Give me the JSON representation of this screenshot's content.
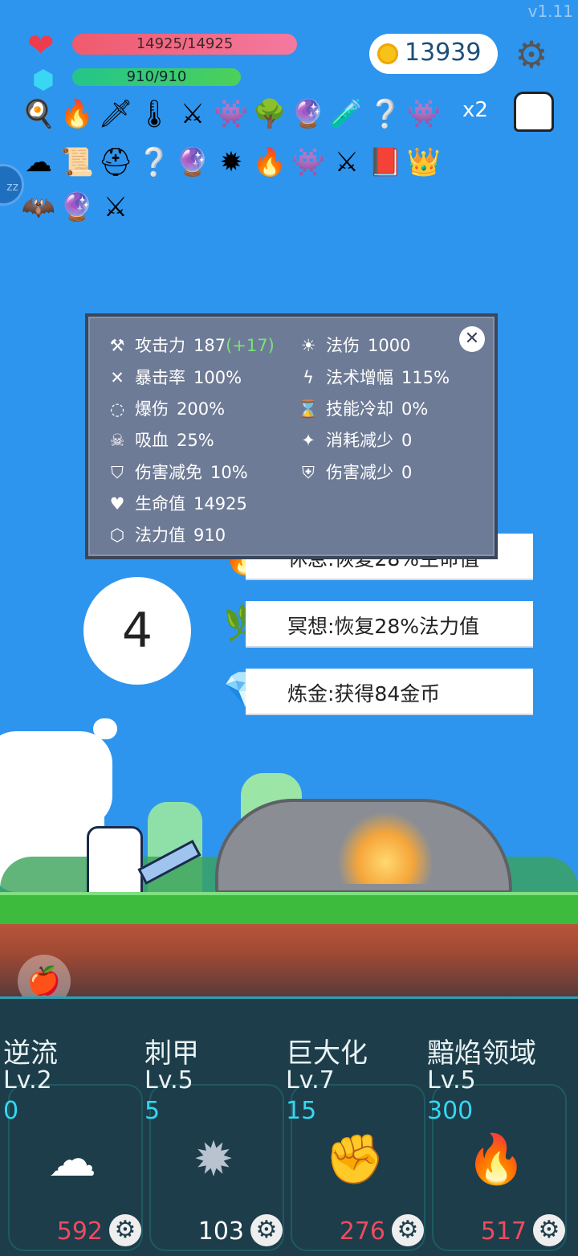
{
  "version": "v1.11",
  "hud": {
    "hp_text": "14925/14925",
    "mp_text": "910/910",
    "gold": "13939",
    "multiplier": "x2"
  },
  "inventory_icons": [
    "egg-icon",
    "torch-icon",
    "dagger-icon",
    "thermometer-icon",
    "sword-icon",
    "green-slime-icon",
    "tree-icon",
    "crystal-ball-icon",
    "blue-potion-icon",
    "hook-icon",
    "green-slime-icon",
    "angel-wing-icon",
    "scroll-icon",
    "knight-helmet-icon",
    "hook-icon",
    "crystal-ball-icon",
    "spiked-mace-icon",
    "flame-icon",
    "green-slime-icon",
    "sword-icon",
    "skull-book-icon",
    "crown-icon",
    "bat-icon",
    "crystal-ball-icon",
    "sword-icon"
  ],
  "stats": {
    "left": [
      {
        "label": "攻击力",
        "value": "187",
        "bonus": "(+17)",
        "icon": "axe-icon"
      },
      {
        "label": "暴击率",
        "value": "100%",
        "icon": "crit-icon"
      },
      {
        "label": "爆伤",
        "value": "200%",
        "icon": "burst-icon"
      },
      {
        "label": "吸血",
        "value": "25%",
        "icon": "skull-icon"
      },
      {
        "label": "伤害减免",
        "value": "10%",
        "icon": "shield-icon"
      },
      {
        "label": "生命值",
        "value": "14925",
        "icon": "heart-icon"
      },
      {
        "label": "法力值",
        "value": "910",
        "icon": "gem-icon"
      }
    ],
    "right": [
      {
        "label": "法伤",
        "value": "1000",
        "icon": "sun-icon"
      },
      {
        "label": "法术增幅",
        "value": "115%",
        "icon": "lightning-icon"
      },
      {
        "label": "技能冷却",
        "value": "0%",
        "icon": "hourglass-icon"
      },
      {
        "label": "消耗减少",
        "value": "0",
        "icon": "magic-wand-icon"
      },
      {
        "label": "伤害减少",
        "value": "0",
        "icon": "shield-heart-icon"
      }
    ]
  },
  "counter": "4",
  "choices": [
    {
      "text": "休息:恢复28%生命值",
      "icon": "fire-icon"
    },
    {
      "text": "冥想:恢复28%法力值",
      "icon": "leaf-icon"
    },
    {
      "text": "炼金:获得84金币",
      "icon": "diamond-icon"
    }
  ],
  "skills": [
    {
      "name": "逆流",
      "level": "Lv.2",
      "cost": "0",
      "price": "592",
      "price_color": "#ef4a5f",
      "icon": "wing-icon"
    },
    {
      "name": "刺甲",
      "level": "Lv.5",
      "cost": "5",
      "price": "103",
      "price_color": "#ffffff",
      "icon": "mace-icon"
    },
    {
      "name": "巨大化",
      "level": "Lv.7",
      "cost": "15",
      "price": "276",
      "price_color": "#ef4a5f",
      "icon": "fist-icon"
    },
    {
      "name": "黯焰领域",
      "level": "Lv.5",
      "cost": "300",
      "price": "517",
      "price_color": "#ef4a5f",
      "icon": "campfire-icon"
    }
  ]
}
